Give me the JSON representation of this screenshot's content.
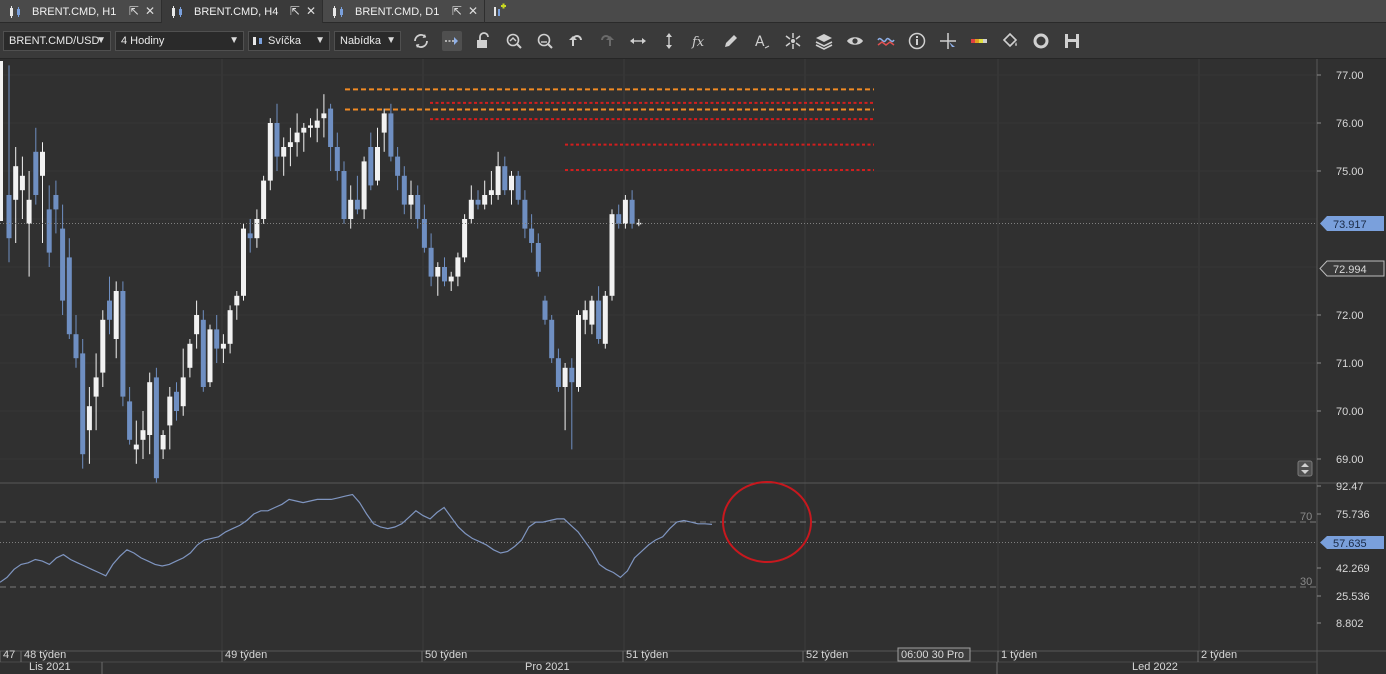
{
  "tabs": [
    {
      "label": "BRENT.CMD, H1",
      "active": false
    },
    {
      "label": "BRENT.CMD, H4",
      "active": true
    },
    {
      "label": "BRENT.CMD, D1",
      "active": false
    }
  ],
  "toolbar": {
    "instrument": "BRENT.CMD/USD",
    "period": "4 Hodiny",
    "chart_type": "Svíčka",
    "offer_side": "Nabídka",
    "tools": [
      "refresh-icon",
      "shift-chart-icon",
      "lock-icon",
      "zoom-in-icon",
      "zoom-out-icon",
      "undo-icon",
      "redo-icon",
      "horizontal-arrows-icon",
      "vertical-arrows-icon",
      "formula-icon",
      "pencil-icon",
      "text-icon",
      "crosshair-cluster-icon",
      "layers-icon",
      "eye-icon",
      "indicator-icon",
      "info-icon",
      "cursor-cross-icon",
      "color-bar-icon",
      "bucket-icon",
      "settings-ring-icon",
      "save-icon"
    ]
  },
  "chart_data": {
    "type": "candlestick",
    "price_axis": {
      "ticks": [
        "77.00",
        "76.00",
        "75.00",
        "73.917",
        "72.994",
        "72.00",
        "71.00",
        "70.00",
        "69.00"
      ],
      "ylim": [
        68.5,
        77.5
      ]
    },
    "current_price_label": "73.917",
    "secondary_price_label": "72.994",
    "candles": [
      {
        "o": 74.5,
        "h": 77.2,
        "l": 73.1,
        "c": 73.6
      },
      {
        "o": 74.4,
        "h": 75.5,
        "l": 73.5,
        "c": 75.1
      },
      {
        "o": 74.6,
        "h": 75.3,
        "l": 74.0,
        "c": 74.9
      },
      {
        "o": 73.9,
        "h": 75.0,
        "l": 72.8,
        "c": 74.4
      },
      {
        "o": 75.4,
        "h": 75.9,
        "l": 74.3,
        "c": 74.5
      },
      {
        "o": 74.9,
        "h": 75.6,
        "l": 73.5,
        "c": 75.4
      },
      {
        "o": 74.2,
        "h": 74.7,
        "l": 73.0,
        "c": 73.3
      },
      {
        "o": 74.5,
        "h": 74.8,
        "l": 73.7,
        "c": 74.2
      },
      {
        "o": 73.8,
        "h": 74.3,
        "l": 72.0,
        "c": 72.3
      },
      {
        "o": 73.2,
        "h": 73.6,
        "l": 71.5,
        "c": 71.6
      },
      {
        "o": 71.6,
        "h": 72.0,
        "l": 70.9,
        "c": 71.1
      },
      {
        "o": 71.2,
        "h": 71.5,
        "l": 68.8,
        "c": 69.1
      },
      {
        "o": 69.6,
        "h": 70.5,
        "l": 68.9,
        "c": 70.1
      },
      {
        "o": 70.3,
        "h": 71.2,
        "l": 69.6,
        "c": 70.7
      },
      {
        "o": 70.8,
        "h": 72.1,
        "l": 70.5,
        "c": 71.9
      },
      {
        "o": 72.3,
        "h": 72.8,
        "l": 71.6,
        "c": 71.9
      },
      {
        "o": 71.5,
        "h": 72.7,
        "l": 71.1,
        "c": 72.5
      },
      {
        "o": 72.5,
        "h": 72.7,
        "l": 70.1,
        "c": 70.3
      },
      {
        "o": 70.2,
        "h": 70.5,
        "l": 69.3,
        "c": 69.4
      },
      {
        "o": 69.2,
        "h": 69.8,
        "l": 68.9,
        "c": 69.3
      },
      {
        "o": 69.4,
        "h": 70.0,
        "l": 69.0,
        "c": 69.6
      },
      {
        "o": 69.5,
        "h": 70.8,
        "l": 69.1,
        "c": 70.6
      },
      {
        "o": 70.7,
        "h": 70.9,
        "l": 68.5,
        "c": 68.6
      },
      {
        "o": 69.2,
        "h": 69.6,
        "l": 69.0,
        "c": 69.5
      },
      {
        "o": 69.7,
        "h": 70.5,
        "l": 69.2,
        "c": 70.3
      },
      {
        "o": 70.4,
        "h": 70.6,
        "l": 69.8,
        "c": 70.0
      },
      {
        "o": 70.1,
        "h": 71.3,
        "l": 69.9,
        "c": 70.7
      },
      {
        "o": 70.9,
        "h": 71.5,
        "l": 70.7,
        "c": 71.4
      },
      {
        "o": 71.6,
        "h": 72.3,
        "l": 71.3,
        "c": 72.0
      },
      {
        "o": 71.9,
        "h": 72.1,
        "l": 70.4,
        "c": 70.5
      },
      {
        "o": 70.6,
        "h": 71.8,
        "l": 70.5,
        "c": 71.7
      },
      {
        "o": 71.7,
        "h": 72.0,
        "l": 71.0,
        "c": 71.3
      },
      {
        "o": 71.3,
        "h": 71.6,
        "l": 71.0,
        "c": 71.4
      },
      {
        "o": 71.4,
        "h": 72.2,
        "l": 71.2,
        "c": 72.1
      },
      {
        "o": 72.2,
        "h": 72.5,
        "l": 71.9,
        "c": 72.4
      },
      {
        "o": 72.4,
        "h": 73.9,
        "l": 72.3,
        "c": 73.8
      },
      {
        "o": 73.7,
        "h": 74.0,
        "l": 73.3,
        "c": 73.6
      },
      {
        "o": 73.6,
        "h": 74.2,
        "l": 73.4,
        "c": 74.0
      },
      {
        "o": 74.0,
        "h": 74.9,
        "l": 73.9,
        "c": 74.8
      },
      {
        "o": 74.8,
        "h": 76.1,
        "l": 74.6,
        "c": 76.0
      },
      {
        "o": 76.0,
        "h": 76.4,
        "l": 75.0,
        "c": 75.3
      },
      {
        "o": 75.3,
        "h": 75.7,
        "l": 74.9,
        "c": 75.5
      },
      {
        "o": 75.5,
        "h": 75.9,
        "l": 75.1,
        "c": 75.6
      },
      {
        "o": 75.6,
        "h": 76.2,
        "l": 75.3,
        "c": 75.8
      },
      {
        "o": 75.8,
        "h": 76.0,
        "l": 75.4,
        "c": 75.9
      },
      {
        "o": 75.9,
        "h": 76.1,
        "l": 75.7,
        "c": 75.95
      },
      {
        "o": 75.9,
        "h": 76.3,
        "l": 75.6,
        "c": 76.05
      },
      {
        "o": 76.1,
        "h": 76.6,
        "l": 75.7,
        "c": 76.2
      },
      {
        "o": 76.3,
        "h": 76.4,
        "l": 75.0,
        "c": 75.5
      },
      {
        "o": 75.5,
        "h": 75.8,
        "l": 74.8,
        "c": 75.0
      },
      {
        "o": 75.0,
        "h": 75.2,
        "l": 73.9,
        "c": 74.0
      },
      {
        "o": 74.0,
        "h": 74.7,
        "l": 73.8,
        "c": 74.4
      },
      {
        "o": 74.4,
        "h": 74.9,
        "l": 74.1,
        "c": 74.2
      },
      {
        "o": 74.2,
        "h": 75.3,
        "l": 74.0,
        "c": 75.2
      },
      {
        "o": 75.5,
        "h": 75.8,
        "l": 74.6,
        "c": 74.7
      },
      {
        "o": 74.8,
        "h": 75.9,
        "l": 74.7,
        "c": 75.5
      },
      {
        "o": 75.8,
        "h": 76.3,
        "l": 75.4,
        "c": 76.2
      },
      {
        "o": 76.2,
        "h": 76.4,
        "l": 75.2,
        "c": 75.3
      },
      {
        "o": 75.3,
        "h": 75.5,
        "l": 74.6,
        "c": 74.9
      },
      {
        "o": 74.9,
        "h": 75.1,
        "l": 74.1,
        "c": 74.3
      },
      {
        "o": 74.3,
        "h": 74.8,
        "l": 74.0,
        "c": 74.5
      },
      {
        "o": 74.5,
        "h": 74.7,
        "l": 73.8,
        "c": 74.0
      },
      {
        "o": 74.0,
        "h": 74.3,
        "l": 73.3,
        "c": 73.4
      },
      {
        "o": 73.4,
        "h": 73.7,
        "l": 72.6,
        "c": 72.8
      },
      {
        "o": 72.8,
        "h": 73.1,
        "l": 72.4,
        "c": 73.0
      },
      {
        "o": 73.0,
        "h": 73.2,
        "l": 72.6,
        "c": 72.7
      },
      {
        "o": 72.7,
        "h": 72.9,
        "l": 72.5,
        "c": 72.8
      },
      {
        "o": 72.8,
        "h": 73.3,
        "l": 72.6,
        "c": 73.2
      },
      {
        "o": 73.2,
        "h": 74.1,
        "l": 73.1,
        "c": 74.0
      },
      {
        "o": 74.0,
        "h": 74.7,
        "l": 73.9,
        "c": 74.4
      },
      {
        "o": 74.4,
        "h": 74.6,
        "l": 74.2,
        "c": 74.3
      },
      {
        "o": 74.3,
        "h": 74.8,
        "l": 74.2,
        "c": 74.5
      },
      {
        "o": 74.5,
        "h": 75.0,
        "l": 74.3,
        "c": 74.6
      },
      {
        "o": 74.5,
        "h": 75.4,
        "l": 74.4,
        "c": 75.1
      },
      {
        "o": 75.1,
        "h": 75.3,
        "l": 74.5,
        "c": 74.6
      },
      {
        "o": 74.6,
        "h": 75.0,
        "l": 74.3,
        "c": 74.9
      },
      {
        "o": 74.9,
        "h": 75.0,
        "l": 74.3,
        "c": 74.4
      },
      {
        "o": 74.4,
        "h": 74.6,
        "l": 73.6,
        "c": 73.8
      },
      {
        "o": 73.8,
        "h": 74.1,
        "l": 73.3,
        "c": 73.5
      },
      {
        "o": 73.5,
        "h": 73.7,
        "l": 72.8,
        "c": 72.9
      },
      {
        "o": 72.3,
        "h": 72.4,
        "l": 71.8,
        "c": 71.9
      },
      {
        "o": 71.9,
        "h": 72.0,
        "l": 71.0,
        "c": 71.1
      },
      {
        "o": 71.1,
        "h": 71.3,
        "l": 70.4,
        "c": 70.5
      },
      {
        "o": 70.5,
        "h": 71.0,
        "l": 69.6,
        "c": 70.9
      },
      {
        "o": 70.9,
        "h": 71.1,
        "l": 69.2,
        "c": 70.6
      },
      {
        "o": 70.5,
        "h": 72.1,
        "l": 70.4,
        "c": 72.0
      },
      {
        "o": 71.9,
        "h": 72.3,
        "l": 71.6,
        "c": 72.1
      },
      {
        "o": 71.8,
        "h": 72.4,
        "l": 71.6,
        "c": 72.3
      },
      {
        "o": 72.3,
        "h": 72.6,
        "l": 71.4,
        "c": 71.5
      },
      {
        "o": 71.4,
        "h": 72.5,
        "l": 71.3,
        "c": 72.4
      },
      {
        "o": 72.4,
        "h": 74.2,
        "l": 72.3,
        "c": 74.1
      },
      {
        "o": 74.1,
        "h": 74.3,
        "l": 73.8,
        "c": 73.9
      },
      {
        "o": 73.9,
        "h": 74.5,
        "l": 73.8,
        "c": 74.4
      },
      {
        "o": 74.4,
        "h": 74.6,
        "l": 73.8,
        "c": 73.9
      },
      {
        "o": 73.9,
        "h": 74.0,
        "l": 73.85,
        "c": 73.92
      }
    ],
    "levels": [
      {
        "value": 76.7,
        "color": "#f08a24"
      },
      {
        "value": 76.28,
        "color": "#f08a24"
      },
      {
        "value": 76.42,
        "color": "#d21e1e"
      },
      {
        "value": 76.08,
        "color": "#d21e1e"
      },
      {
        "value": 75.55,
        "color": "#d21e1e"
      },
      {
        "value": 75.02,
        "color": "#d21e1e"
      }
    ],
    "oscillator": {
      "ticks": [
        "92.47",
        "75.736",
        "57.635",
        "42.269",
        "25.536",
        "8.802"
      ],
      "ylim": [
        0,
        100
      ],
      "upper_level": "70",
      "lower_level": "30",
      "current_value_label": "57.635",
      "values": [
        22,
        25,
        30,
        33,
        34,
        36,
        35,
        33,
        37,
        39,
        36,
        34,
        32,
        30,
        28,
        26,
        33,
        38,
        42,
        40,
        37,
        35,
        33,
        32,
        33,
        35,
        37,
        40,
        45,
        48,
        49,
        50,
        53,
        55,
        57,
        60,
        64,
        66,
        66,
        68,
        70,
        73,
        72,
        71,
        72,
        73,
        73,
        73,
        74,
        75,
        76,
        71,
        64,
        58,
        56,
        55,
        56,
        58,
        62,
        66,
        63,
        61,
        65,
        68,
        62,
        56,
        52,
        49,
        47,
        45,
        42,
        40,
        41,
        44,
        48,
        56,
        59,
        59,
        60,
        61,
        61,
        57,
        53,
        47,
        41,
        33,
        30,
        28,
        25,
        29,
        37,
        41,
        45,
        48,
        50,
        55,
        59,
        60,
        59,
        58,
        58,
        57.6
      ],
      "highlight": "red-circle"
    },
    "time_axis": {
      "week_labels": [
        "47",
        "48 týden",
        "49 týden",
        "50 týden",
        "51 týden",
        "52 týden",
        "1 týden",
        "2 týden"
      ],
      "cursor_label": "06:00 30 Pro",
      "month_labels": [
        "Lis 2021",
        "Pro 2021",
        "Led 2022"
      ]
    },
    "colors": {
      "bull": "#f2f2f2",
      "bear": "#6f8fc2",
      "background": "#303030",
      "grid": "#3c3c3c",
      "oscillator_line": "#7f95c0"
    }
  }
}
